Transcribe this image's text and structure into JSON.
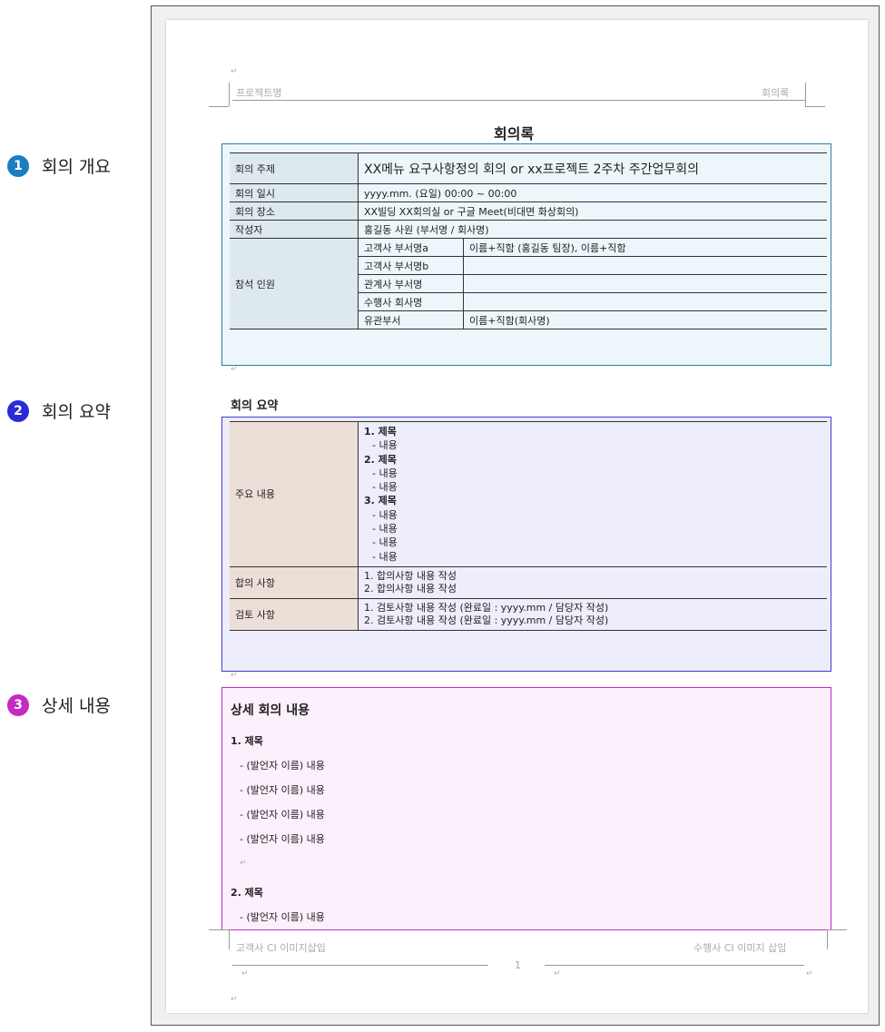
{
  "annotations": [
    {
      "num": "1",
      "label": "회의 개요",
      "color": "#1a7fc1"
    },
    {
      "num": "2",
      "label": "회의 요약",
      "color": "#2b2bd8"
    },
    {
      "num": "3",
      "label": "상세 내용",
      "color": "#c42ac4"
    }
  ],
  "header": {
    "left": "프로젝트명",
    "right": "회의록"
  },
  "doc_title": "회의록",
  "overview": {
    "rows": [
      {
        "label": "회의 주제",
        "value": "XX메뉴 요구사항정의 회의 or xx프로젝트 2주차 주간업무회의"
      },
      {
        "label": "회의 일시",
        "value": "yyyy.mm. (요일) 00:00 ~ 00:00"
      },
      {
        "label": "회의 장소",
        "value": "XX빌딩 XX회의실 or 구글 Meet(비대면 화상회의)"
      },
      {
        "label": "작성자",
        "value": "홍길동 사원 (부서명 / 회사명)"
      }
    ],
    "attendees_label": "참석 인원",
    "attendees": [
      {
        "org": "고객사 부서명a",
        "names": "이름+직함 (홍길동 팀장), 이름+직함"
      },
      {
        "org": "고객사 부서명b",
        "names": ""
      },
      {
        "org": "관계사 부서명",
        "names": ""
      },
      {
        "org": "수행사 회사명",
        "names": ""
      },
      {
        "org": "유관부서",
        "names": "이름+직함(회사명)"
      }
    ]
  },
  "summary": {
    "title": "회의 요약",
    "main_label": "주요 내용",
    "main_lines": [
      {
        "text": "1. 제목",
        "bold": true
      },
      {
        "text": "- 내용",
        "indent": true
      },
      {
        "text": "2. 제목",
        "bold": true
      },
      {
        "text": "- 내용",
        "indent": true
      },
      {
        "text": "- 내용",
        "indent": true
      },
      {
        "text": "3. 제목",
        "bold": true
      },
      {
        "text": "- 내용",
        "indent": true
      },
      {
        "text": "- 내용",
        "indent": true
      },
      {
        "text": "- 내용",
        "indent": true
      },
      {
        "text": "- 내용",
        "indent": true
      }
    ],
    "agreement_label": "합의 사항",
    "agreement_lines": [
      "1. 합의사항 내용 작성",
      "2. 합의사항 내용 작성"
    ],
    "review_label": "검토 사항",
    "review_lines": [
      "1. 검토사항 내용 작성 (완료일 : yyyy.mm / 담당자 작성)",
      "2. 검토사항 내용 작성 (완료일 : yyyy.mm / 담당자 작성)"
    ]
  },
  "detail": {
    "title": "상세 회의 내용",
    "items": [
      {
        "heading": "1. 제목",
        "lines": [
          "- (발언자 이름) 내용",
          "- (발언자 이름) 내용",
          "- (발언자 이름) 내용",
          "- (발언자 이름) 내용"
        ]
      },
      {
        "heading": "2. 제목",
        "lines": [
          "- (발언자 이름) 내용"
        ]
      }
    ]
  },
  "footer": {
    "left": "고객사 CI 이미지삽입",
    "right": "수행사 CI 이미지 삽입",
    "page": "1"
  }
}
